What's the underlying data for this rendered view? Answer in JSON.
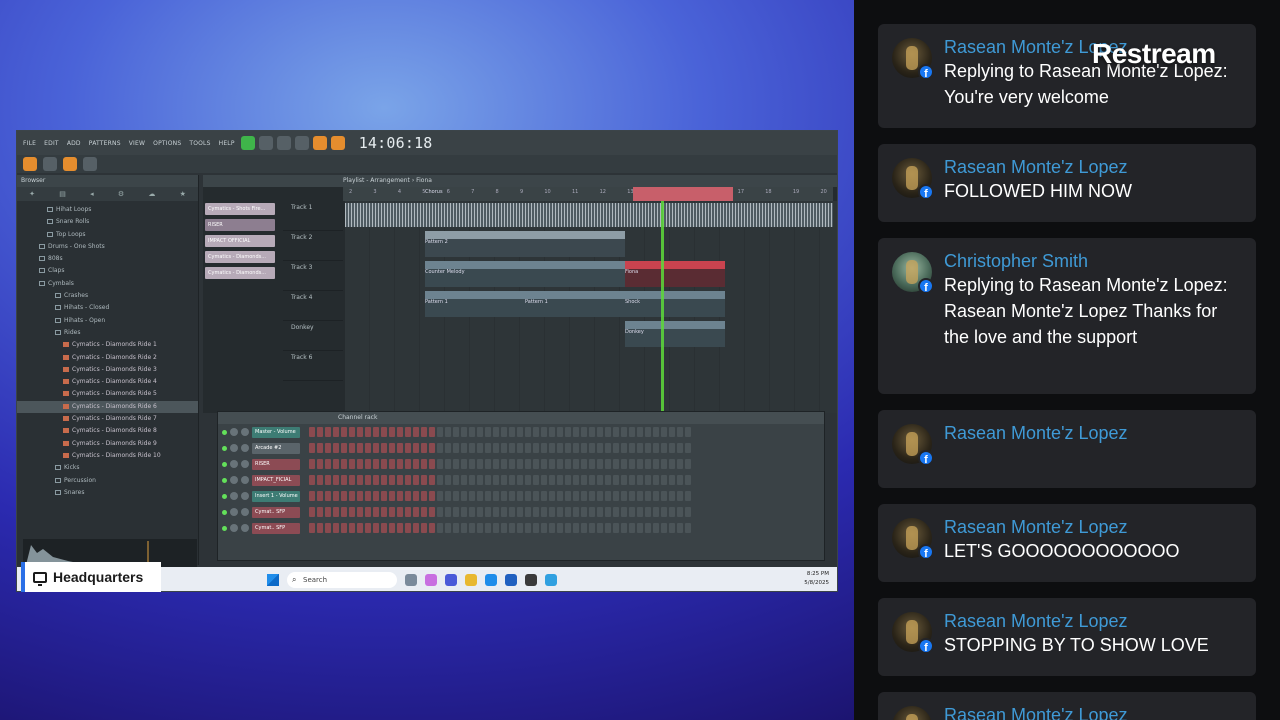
{
  "overlay": {
    "logo_text": "Restream",
    "source_label": "Headquarters"
  },
  "daw": {
    "menu": [
      "FILE",
      "EDIT",
      "ADD",
      "PATTERNS",
      "VIEW",
      "OPTIONS",
      "TOOLS",
      "HELP"
    ],
    "time_display": "14:06:18",
    "playlist_title": "Playlist - Arrangement › Fiona",
    "browser_title": "Browser",
    "channel_rack_title": "Channel rack",
    "browser_items": [
      {
        "label": "Hihat Loops",
        "kind": "folder"
      },
      {
        "label": "Snare Rolls",
        "kind": "folder"
      },
      {
        "label": "Top Loops",
        "kind": "folder"
      },
      {
        "label": "Drums - One Shots",
        "kind": "folder"
      },
      {
        "label": "808s",
        "kind": "folder"
      },
      {
        "label": "Claps",
        "kind": "folder"
      },
      {
        "label": "Cymbals",
        "kind": "folder"
      },
      {
        "label": "Crashes",
        "kind": "folder"
      },
      {
        "label": "Hihats - Closed",
        "kind": "folder"
      },
      {
        "label": "Hihats - Open",
        "kind": "folder"
      },
      {
        "label": "Rides",
        "kind": "folder"
      },
      {
        "label": "Cymatics - Diamonds Ride 1",
        "kind": "file"
      },
      {
        "label": "Cymatics - Diamonds Ride 2",
        "kind": "file"
      },
      {
        "label": "Cymatics - Diamonds Ride 3",
        "kind": "file"
      },
      {
        "label": "Cymatics - Diamonds Ride 4",
        "kind": "file"
      },
      {
        "label": "Cymatics - Diamonds Ride 5",
        "kind": "file"
      },
      {
        "label": "Cymatics - Diamonds Ride 6",
        "kind": "file-selected"
      },
      {
        "label": "Cymatics - Diamonds Ride 7",
        "kind": "file"
      },
      {
        "label": "Cymatics - Diamonds Ride 8",
        "kind": "file"
      },
      {
        "label": "Cymatics - Diamonds Ride 9",
        "kind": "file"
      },
      {
        "label": "Cymatics - Diamonds Ride 10",
        "kind": "file"
      },
      {
        "label": "Kicks",
        "kind": "folder"
      },
      {
        "label": "Percussion",
        "kind": "folder"
      },
      {
        "label": "Snares",
        "kind": "folder"
      }
    ],
    "patterns": [
      "Cymatics - Shots Fire...",
      "RISER",
      "IMPACT OFFICIAL",
      "Cymatics - Diamonds...",
      "Cymatics - Diamonds..."
    ],
    "tracks": [
      "Track 1",
      "Track 2",
      "Track 3",
      "Track 4",
      "Donkey",
      "Track 6"
    ],
    "clips": {
      "chorus": "Chorus",
      "pattern2": "Pattern 2",
      "counter_melody": "Counter Melody",
      "fiona": "Fiona",
      "pattern1a": "Pattern 1",
      "pattern1b": "Pattern 1",
      "shock": "Shock",
      "donkey": "Donkey"
    },
    "channels": [
      {
        "name": "Master - Volume",
        "color": "teal"
      },
      {
        "name": "Arcade #2",
        "color": "gray"
      },
      {
        "name": "RISER",
        "color": "red"
      },
      {
        "name": "IMPACT_FICIAL",
        "color": "red"
      },
      {
        "name": "Insert 1 - Volume",
        "color": "teal"
      },
      {
        "name": "Cymat.. SFP",
        "color": "red"
      },
      {
        "name": "Cymat.. SFP",
        "color": "red"
      }
    ]
  },
  "taskbar": {
    "search_placeholder": "Search",
    "time": "8:25 PM",
    "date": "5/8/2025"
  },
  "chat": {
    "messages": [
      {
        "name": "Rasean Monte'z Lopez",
        "text": "Replying to Rasean Monte'z Lopez: You're very welcome",
        "platform": "facebook"
      },
      {
        "name": "Rasean Monte'z Lopez",
        "text": "FOLLOWED HIM NOW",
        "platform": "facebook"
      },
      {
        "name": "Christopher Smith",
        "text": "Replying to Rasean Monte'z Lopez: Rasean Monte'z Lopez Thanks for the love and the support",
        "platform": "facebook"
      },
      {
        "name": "Rasean Monte'z Lopez",
        "text": "",
        "platform": "facebook"
      },
      {
        "name": "Rasean Monte'z Lopez",
        "text": "LET'S GOOOOOOOOOOOO",
        "platform": "facebook"
      },
      {
        "name": "Rasean Monte'z Lopez",
        "text": "STOPPING BY TO SHOW LOVE",
        "platform": "facebook"
      },
      {
        "name": "Rasean Monte'z Lopez",
        "text": "",
        "platform": "facebook"
      }
    ]
  },
  "colors": {
    "chat_name": "#3f9ad6",
    "chat_bubble": "#232428",
    "facebook": "#1877f2"
  }
}
